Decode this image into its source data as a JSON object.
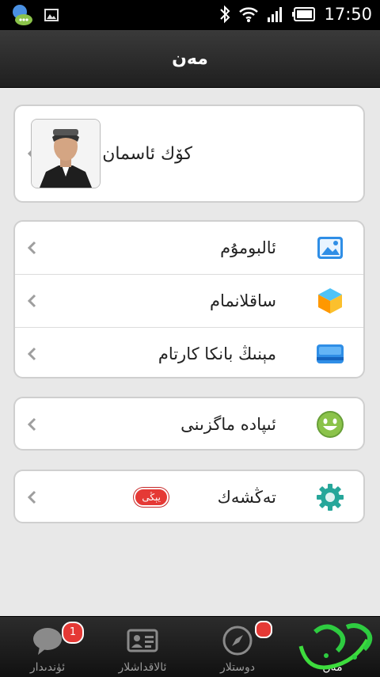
{
  "status_bar": {
    "time": "17:50",
    "left_icons": [
      "chat-notification-icon",
      "image-icon"
    ],
    "right_icons": [
      "bluetooth-icon",
      "wifi-icon",
      "signal-icon",
      "battery-icon"
    ]
  },
  "header": {
    "title": "مەن"
  },
  "profile": {
    "name": "كۆك ئاسمان"
  },
  "menu_group_1": {
    "items": [
      {
        "label": "ئالبومۇم",
        "icon": "album-icon"
      },
      {
        "label": "ساقلانمام",
        "icon": "favorites-cube-icon"
      },
      {
        "label": "مېنىڭ بانكا كارتام",
        "icon": "bank-card-icon"
      }
    ]
  },
  "menu_group_2": {
    "items": [
      {
        "label": "ئىپادە ماگزىنى",
        "icon": "smiley-icon"
      }
    ]
  },
  "menu_group_3": {
    "items": [
      {
        "label": "تەڭشەك",
        "icon": "settings-gear-icon",
        "badge": "يېڭى"
      }
    ]
  },
  "tab_bar": {
    "tabs": [
      {
        "label": "ئۈندىدار",
        "icon": "chat-bubble-icon",
        "badge": "1"
      },
      {
        "label": "ئالاقداشلار",
        "icon": "contacts-card-icon"
      },
      {
        "label": "دوستلار",
        "icon": "compass-icon"
      },
      {
        "label": "مەن",
        "icon": "me-icon"
      }
    ]
  },
  "colors": {
    "accent_red": "#e53935",
    "titlebar": "#2b2b2b",
    "background": "#e8e8e8"
  }
}
